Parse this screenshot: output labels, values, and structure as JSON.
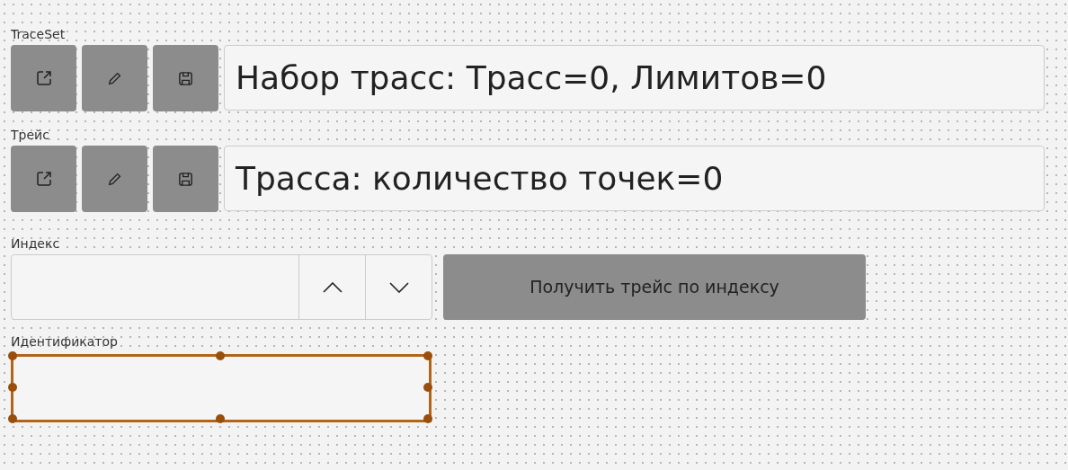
{
  "groups": [
    {
      "label": "TraceSet",
      "display": "Набор трасс: Трасс=0, Лимитов=0"
    },
    {
      "label": "Трейс",
      "display": "Трасса: количество точек=0"
    }
  ],
  "index": {
    "label": "Индекс",
    "button": "Получить трейс по индексу"
  },
  "identifier": {
    "label": "Идентификатор",
    "selected": true
  }
}
